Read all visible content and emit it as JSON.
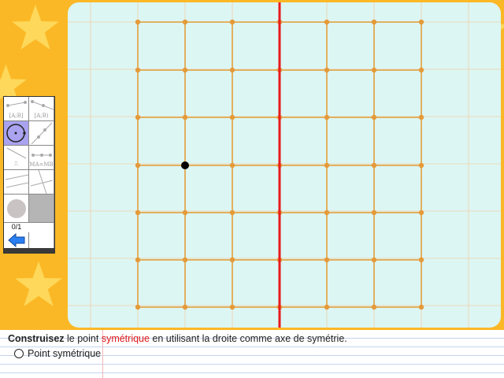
{
  "instruction": {
    "bold": "Construisez",
    "part1": " le point ",
    "highlight": "symétrique",
    "part2": " en utilisant la droite comme axe de symétrie."
  },
  "answer_option": {
    "label": "Point symétrique"
  },
  "toolbar": {
    "segment_label": "[A;B]",
    "ray_label": "[A;B)",
    "compass_label": "⎍",
    "midpoint_label": "MA=MB",
    "score": "0/1"
  },
  "icons": {
    "back": "back-arrow-icon",
    "circle": "circle-tool-icon"
  },
  "colors": {
    "background": "#fbb826",
    "workspace": "#dcf6f4",
    "grid_line": "#e2b060",
    "grid_node": "#e59a3a",
    "axis": "#e8191e",
    "point": "#000000",
    "highlight_text": "#e01818"
  }
}
